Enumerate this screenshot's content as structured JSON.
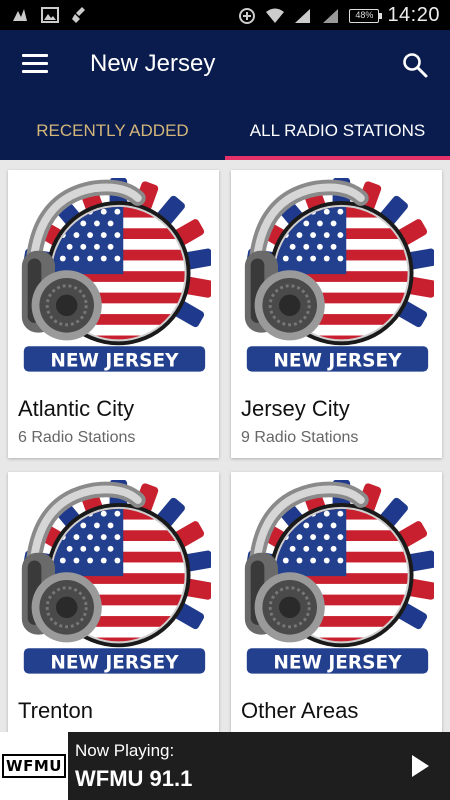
{
  "status_bar": {
    "battery": "48%",
    "time": "14:20"
  },
  "app_bar": {
    "title": "New Jersey"
  },
  "tabs": [
    {
      "label": "RECENTLY ADDED",
      "active": false
    },
    {
      "label": "ALL RADIO STATIONS",
      "active": true
    }
  ],
  "cards": [
    {
      "name": "Atlantic City",
      "count": "6 Radio Stations",
      "badge": "NEW JERSEY"
    },
    {
      "name": "Jersey City",
      "count": "9 Radio Stations",
      "badge": "NEW JERSEY"
    },
    {
      "name": "Trenton",
      "count": "",
      "badge": "NEW JERSEY"
    },
    {
      "name": "Other Areas",
      "count": "",
      "badge": "NEW JERSEY"
    }
  ],
  "now_playing": {
    "logo_text": "WFMU",
    "label": "Now Playing:",
    "station": "WFMU 91.1"
  },
  "colors": {
    "app_bar": "#0a1c4d",
    "tab_indicator": "#e6326b",
    "inactive_tab": "#d4b67a",
    "player_bg": "#1e1e1e"
  }
}
